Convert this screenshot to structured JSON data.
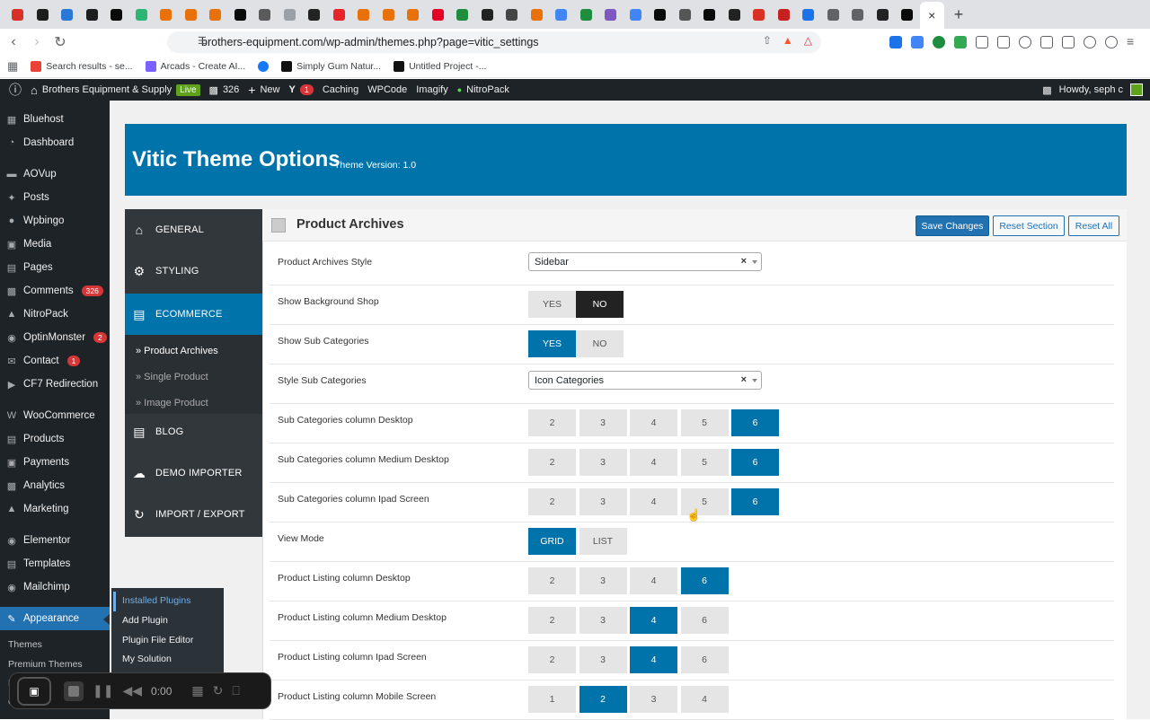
{
  "browser": {
    "tab_favicons": [
      "#d93025",
      "#1d1d1d",
      "#2a78d6",
      "#1d1d1d",
      "#0a0a0a",
      "#2bb673",
      "#e8710a",
      "#e8710a",
      "#e8710a",
      "#0a0a0a",
      "#5a5a5a",
      "#9aa0a6",
      "#222",
      "#e8242b",
      "#e8710a",
      "#e8710a",
      "#e8710a",
      "#e60023",
      "#1e8e3e",
      "#222",
      "#444",
      "#e8710a",
      "#4285f4",
      "#1e8e3e",
      "#7e57c2",
      "#4285f4",
      "#0a0a0a",
      "#555",
      "#0a0a0a",
      "#222",
      "#d93025",
      "#c5221f",
      "#1a73e8",
      "#5f6368",
      "#5f6368",
      "#222",
      "#0a0a0a"
    ],
    "url": "brothers-equipment.com/wp-admin/themes.php?page=vitic_settings",
    "bookmarks": [
      {
        "label": "Search results - se...",
        "color": "#ea4335"
      },
      {
        "label": "Arcads - Create AI...",
        "color": "#7b61ff"
      },
      {
        "label": "",
        "color": "#1877f2"
      },
      {
        "label": "Simply Gum Natur...",
        "color": "#111"
      },
      {
        "label": "Untitled Project -...",
        "color": "#111"
      }
    ]
  },
  "adminbar": {
    "site_name": "Brothers Equipment & Supply",
    "live_label": "Live",
    "comments_count": "326",
    "new_label": "New",
    "yoast_count": "1",
    "caching": "Caching",
    "wpcode": "WPCode",
    "imagify": "Imagify",
    "nitropack": "NitroPack",
    "howdy": "Howdy, seph c"
  },
  "sidebar": {
    "items": [
      {
        "label": "Bluehost",
        "icon": "grid-icon"
      },
      {
        "label": "Dashboard",
        "icon": "dashboard-icon"
      },
      {
        "label": "AOVup",
        "icon": "aovup-icon"
      },
      {
        "label": "Posts",
        "icon": "pin-icon"
      },
      {
        "label": "Wpbingo",
        "icon": "wpbingo-icon"
      },
      {
        "label": "Media",
        "icon": "media-icon"
      },
      {
        "label": "Pages",
        "icon": "pages-icon"
      },
      {
        "label": "Comments",
        "icon": "comments-icon",
        "badge": "326"
      },
      {
        "label": "NitroPack",
        "icon": "nitropack-icon"
      },
      {
        "label": "OptinMonster",
        "icon": "optinmonster-icon",
        "badge": "2"
      },
      {
        "label": "Contact",
        "icon": "mail-icon",
        "badge": "1"
      },
      {
        "label": "CF7 Redirection",
        "icon": "cf7-icon"
      },
      {
        "label": "WooCommerce",
        "icon": "woocommerce-icon"
      },
      {
        "label": "Products",
        "icon": "products-icon"
      },
      {
        "label": "Payments",
        "icon": "payments-icon"
      },
      {
        "label": "Analytics",
        "icon": "analytics-icon"
      },
      {
        "label": "Marketing",
        "icon": "marketing-icon"
      },
      {
        "label": "Elementor",
        "icon": "elementor-icon"
      },
      {
        "label": "Templates",
        "icon": "folder-icon"
      },
      {
        "label": "Mailchimp",
        "icon": "mailchimp-icon"
      },
      {
        "label": "Appearance",
        "icon": "brush-icon"
      }
    ],
    "appearance_sub": [
      "Themes",
      "Premium Themes",
      "Pa",
      "Cu"
    ],
    "flyout": [
      "Installed Plugins",
      "Add Plugin",
      "Plugin File Editor",
      "My Solution"
    ]
  },
  "recorder": {
    "time": "0:00"
  },
  "theme": {
    "title": "Vitic Theme Options",
    "version": "Theme Version: 1.0",
    "nav": [
      {
        "label": "GENERAL",
        "icon": "home-icon"
      },
      {
        "label": "STYLING",
        "icon": "styling-icon"
      },
      {
        "label": "ECOMMERCE",
        "icon": "cart-icon"
      },
      {
        "label": "BLOG",
        "icon": "blog-icon"
      },
      {
        "label": "DEMO IMPORTER",
        "icon": "cloud-download-icon"
      },
      {
        "label": "IMPORT / EXPORT",
        "icon": "refresh-icon"
      }
    ],
    "subnav": [
      "» Product Archives",
      "» Single Product",
      "» Image Product"
    ],
    "section_title": "Product Archives",
    "save": "Save Changes",
    "reset_section": "Reset Section",
    "reset_all": "Reset All"
  },
  "settings": {
    "archives_style": {
      "label": "Product Archives Style",
      "value": "Sidebar"
    },
    "bg_shop": {
      "label": "Show Background Shop",
      "options": [
        "YES",
        "NO"
      ],
      "selected": "NO"
    },
    "sub_cats": {
      "label": "Show Sub Categories",
      "options": [
        "YES",
        "NO"
      ],
      "selected": "YES"
    },
    "style_sub": {
      "label": "Style Sub Categories",
      "value": "Icon Categories"
    },
    "sub_desktop": {
      "label": "Sub Categories column Desktop",
      "options": [
        "2",
        "3",
        "4",
        "5",
        "6"
      ],
      "selected": "6"
    },
    "sub_medium": {
      "label": "Sub Categories column Medium Desktop",
      "options": [
        "2",
        "3",
        "4",
        "5",
        "6"
      ],
      "selected": "6"
    },
    "sub_ipad": {
      "label": "Sub Categories column Ipad Screen",
      "options": [
        "2",
        "3",
        "4",
        "5",
        "6"
      ],
      "selected": "6"
    },
    "view_mode": {
      "label": "View Mode",
      "options": [
        "GRID",
        "LIST"
      ],
      "selected": "GRID"
    },
    "pl_desktop": {
      "label": "Product Listing column Desktop",
      "options": [
        "2",
        "3",
        "4",
        "6"
      ],
      "selected": "6"
    },
    "pl_medium": {
      "label": "Product Listing column Medium Desktop",
      "options": [
        "2",
        "3",
        "4",
        "6"
      ],
      "selected": "4"
    },
    "pl_ipad": {
      "label": "Product Listing column Ipad Screen",
      "options": [
        "2",
        "3",
        "4",
        "6"
      ],
      "selected": "4"
    },
    "pl_mobile": {
      "label": "Product Listing column Mobile Screen",
      "options": [
        "1",
        "2",
        "3",
        "4"
      ],
      "selected": "2"
    }
  }
}
